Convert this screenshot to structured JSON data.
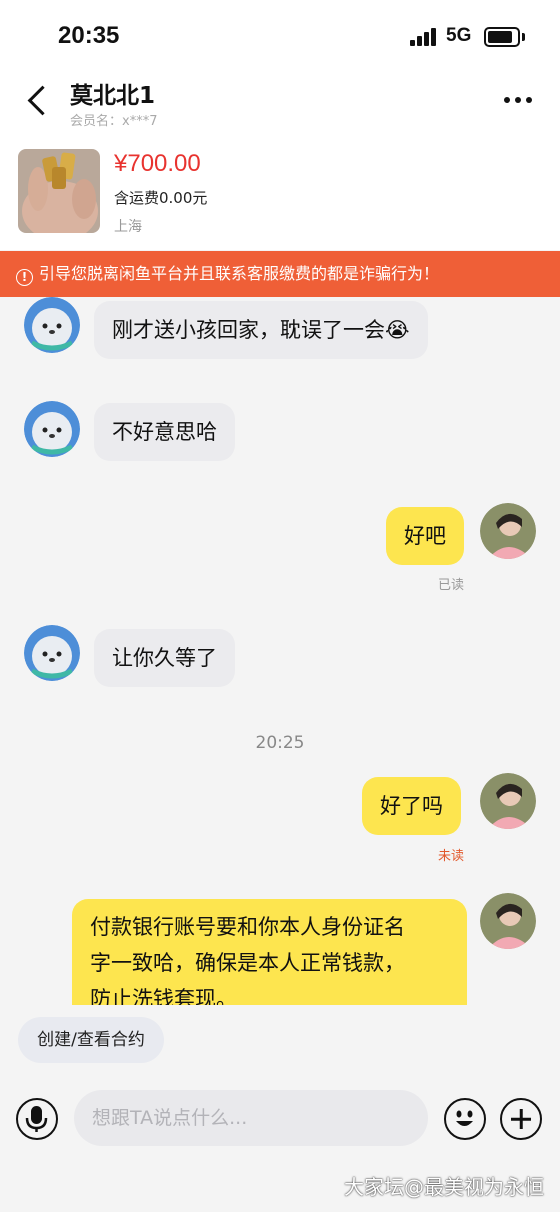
{
  "status_bar": {
    "time": "20:35",
    "network": "5G",
    "battery_level": 0.85
  },
  "header": {
    "back_icon": "chevron-left-icon",
    "contact_name": "莫北北1",
    "member_name": "会员名：x***7",
    "more_icon": "more-horizontal-icon"
  },
  "product": {
    "thumbnail_icon": "gold-bars-photo",
    "price": "¥700.00",
    "shipping": "含运费0.00元",
    "location": "上海"
  },
  "warning": {
    "icon": "alert-circle-icon",
    "text": "引导您脱离闲鱼平台并且联系客服缴费的都是诈骗行为！",
    "background": "#ef5f37"
  },
  "chat": {
    "messages": [
      {
        "direction": "in",
        "text": "刚才送小孩回家，耽误了一会😭"
      },
      {
        "direction": "in",
        "text": "不好意思哈"
      },
      {
        "direction": "out",
        "text": "好吧",
        "read_state": "已读"
      },
      {
        "direction": "in",
        "text": "让你久等了"
      },
      {
        "direction": "out",
        "text": "好了吗",
        "read_state": "未读"
      },
      {
        "direction": "out",
        "lines": [
          "付款银行账号要和你本人身份证名",
          "字一致哈，确保是本人正常钱款，",
          "防止洗钱套现。"
        ]
      }
    ],
    "time_divider": "20:25",
    "colors": {
      "incoming_bubble": "#ebebee",
      "outgoing_bubble": "#fde54f",
      "unread": "#e25a2e"
    }
  },
  "contract_button": {
    "label": "创建/查看合约"
  },
  "input_bar": {
    "voice_icon": "microphone-icon",
    "placeholder": "想跟TA说点什么...",
    "value": "",
    "emoji_icon": "smiley-icon",
    "plus_icon": "plus-circle-icon"
  },
  "watermark": {
    "text": "大家坛@最美视为永恒"
  }
}
